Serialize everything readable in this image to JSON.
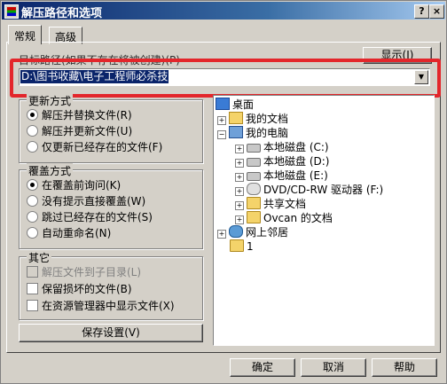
{
  "window": {
    "title": "解压路径和选项",
    "help_btn": "?",
    "close_btn": "×"
  },
  "tabs": [
    {
      "label": "常规"
    },
    {
      "label": "高级"
    }
  ],
  "path": {
    "label": "目标路径(如果不存在将被创建)(P)",
    "value": "D:\\图书收藏\\电子工程师必杀技",
    "show_button": "显示(I)"
  },
  "update_group": {
    "title": "更新方式",
    "options": [
      {
        "label": "解压并替换文件(R)",
        "selected": true
      },
      {
        "label": "解压并更新文件(U)",
        "selected": false
      },
      {
        "label": "仅更新已经存在的文件(F)",
        "selected": false
      }
    ]
  },
  "overwrite_group": {
    "title": "覆盖方式",
    "options": [
      {
        "label": "在覆盖前询问(K)",
        "selected": true
      },
      {
        "label": "没有提示直接覆盖(W)",
        "selected": false
      },
      {
        "label": "跳过已经存在的文件(S)",
        "selected": false
      },
      {
        "label": "自动重命名(N)",
        "selected": false
      }
    ]
  },
  "misc_group": {
    "title": "其它",
    "options": [
      {
        "label": "解压文件到子目录(L)",
        "checked": false,
        "disabled": true
      },
      {
        "label": "保留损坏的文件(B)",
        "checked": false,
        "disabled": false
      },
      {
        "label": "在资源管理器中显示文件(X)",
        "checked": false,
        "disabled": false
      }
    ]
  },
  "save_button": "保存设置(V)",
  "tree": {
    "nodes": [
      {
        "label": "桌面",
        "icon": "desktop-icon"
      },
      {
        "label": "我的文档",
        "icon": "my-documents-icon"
      },
      {
        "label": "我的电脑",
        "icon": "computer-icon"
      },
      {
        "label": "本地磁盘 (C:)",
        "icon": "drive-icon"
      },
      {
        "label": "本地磁盘 (D:)",
        "icon": "drive-icon"
      },
      {
        "label": "本地磁盘 (E:)",
        "icon": "drive-icon"
      },
      {
        "label": "DVD/CD-RW 驱动器 (F:)",
        "icon": "cd-drive-icon"
      },
      {
        "label": "共享文档",
        "icon": "folder-icon"
      },
      {
        "label": "Ovcan 的文档",
        "icon": "folder-icon"
      },
      {
        "label": "网上邻居",
        "icon": "network-icon"
      },
      {
        "label": "1",
        "icon": "folder-icon"
      }
    ]
  },
  "footer": {
    "ok": "确定",
    "cancel": "取消",
    "help": "帮助"
  }
}
